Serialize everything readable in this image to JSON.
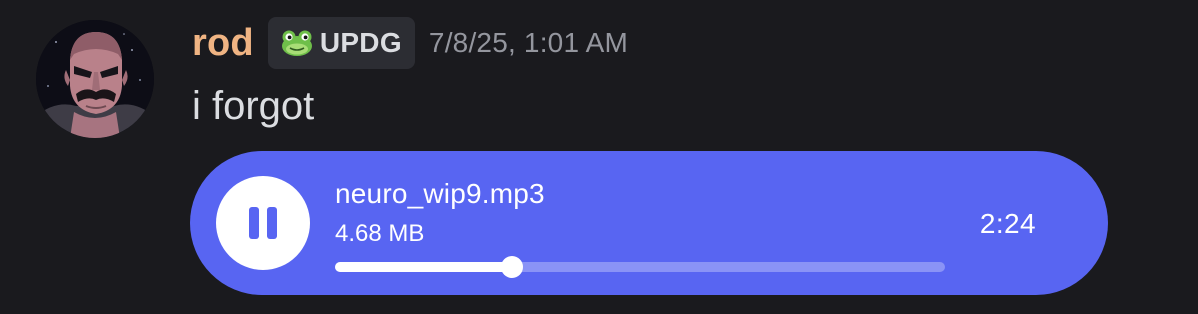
{
  "message": {
    "author": {
      "username": "rod",
      "username_color": "#f0b483",
      "avatar_icon": "bald-mustached-man-avatar"
    },
    "tag": {
      "icon": "frog-icon",
      "label": "UPDG"
    },
    "timestamp": "7/8/25, 1:01 AM",
    "text": "i forgot"
  },
  "attachment": {
    "type": "audio",
    "filename": "neuro_wip9.mp3",
    "filesize": "4.68 MB",
    "duration": "2:24",
    "state": "playing",
    "button_icon": "pause-icon",
    "progress_fraction": 0.29,
    "accent_color": "#5865f2"
  }
}
